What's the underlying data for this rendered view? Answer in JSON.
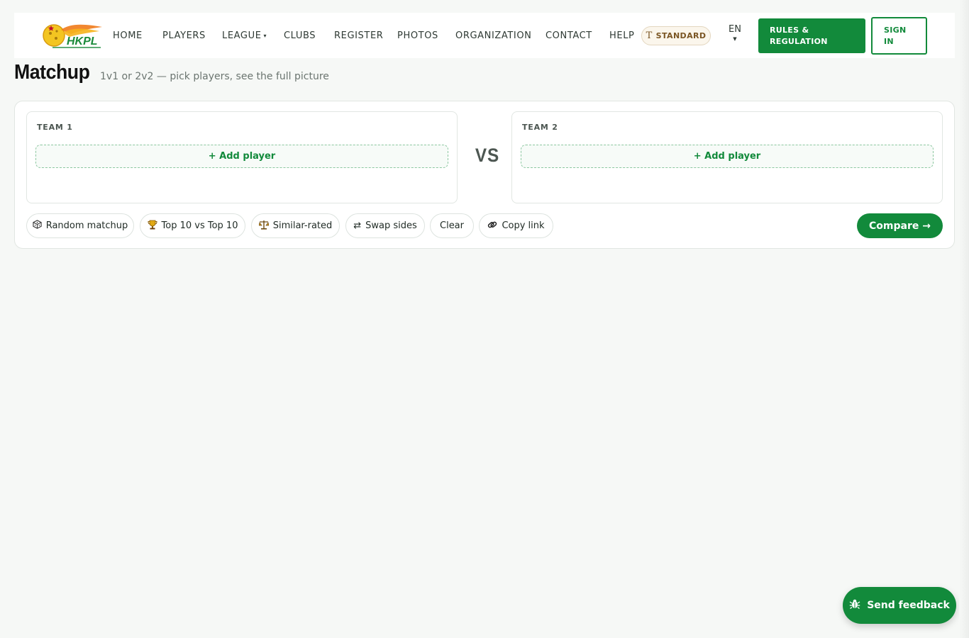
{
  "nav": {
    "logo_text": "HKPL",
    "items": [
      {
        "label": "HOME"
      },
      {
        "label": "PLAYERS"
      },
      {
        "label": "LEAGUE"
      },
      {
        "label": "CLUBS"
      },
      {
        "label": "REGISTER"
      },
      {
        "label": "PHOTOS"
      },
      {
        "label": "ORGANIZATION"
      },
      {
        "label": "CONTACT"
      },
      {
        "label": "HELP"
      }
    ],
    "mode_pill": "STANDARD",
    "language": "EN",
    "rules_button": "RULES & REGULATION",
    "signin_button": "SIGN IN"
  },
  "page": {
    "title": "Matchup",
    "subtitle": "1v1 or 2v2 — pick players, see the full picture"
  },
  "matchup": {
    "team1_label": "TEAM 1",
    "team2_label": "TEAM 2",
    "add_player": "+ Add player",
    "vs": "VS",
    "actions": {
      "random": "Random matchup",
      "top10": "Top 10 vs Top 10",
      "similar": "Similar-rated",
      "swap": "Swap sides",
      "clear": "Clear",
      "copy": "Copy link"
    },
    "compare": "Compare →"
  },
  "feedback": {
    "label": "Send feedback"
  },
  "colors": {
    "brand_green": "#128a3b",
    "background": "#f6f8f6"
  }
}
